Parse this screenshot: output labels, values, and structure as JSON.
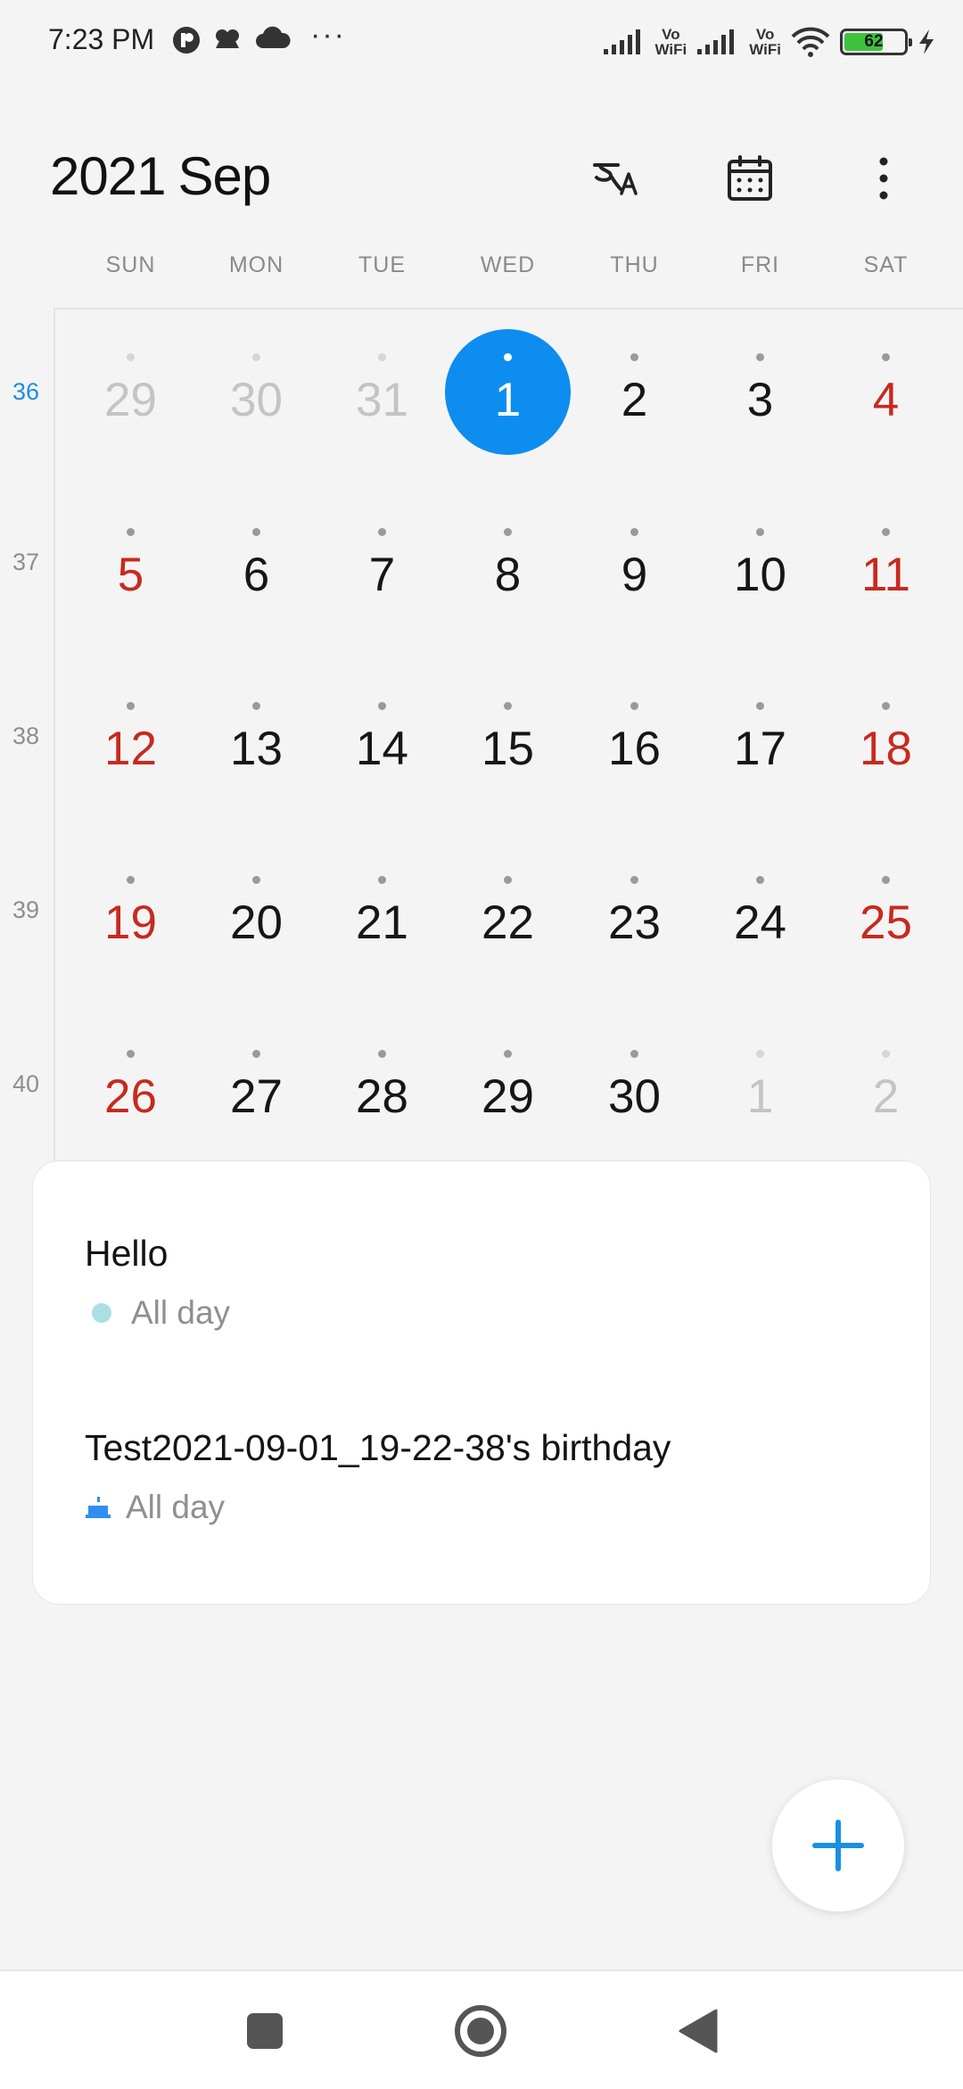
{
  "status_bar": {
    "time": "7:23 PM",
    "more": "···",
    "vowifi_1": [
      "Vo",
      "WiFi"
    ],
    "vowifi_2": [
      "Vo",
      "WiFi"
    ],
    "battery_level": "62"
  },
  "header": {
    "year": "2021",
    "month": "Sep"
  },
  "weekdays": [
    "SUN",
    "MON",
    "TUE",
    "WED",
    "THU",
    "FRI",
    "SAT"
  ],
  "weeks": [
    {
      "number": "36",
      "days": [
        "29",
        "30",
        "31",
        "1",
        "2",
        "3",
        "4"
      ]
    },
    {
      "number": "37",
      "days": [
        "5",
        "6",
        "7",
        "8",
        "9",
        "10",
        "11"
      ]
    },
    {
      "number": "38",
      "days": [
        "12",
        "13",
        "14",
        "15",
        "16",
        "17",
        "18"
      ]
    },
    {
      "number": "39",
      "days": [
        "19",
        "20",
        "21",
        "22",
        "23",
        "24",
        "25"
      ]
    },
    {
      "number": "40",
      "days": [
        "26",
        "27",
        "28",
        "29",
        "30",
        "1",
        "2"
      ]
    }
  ],
  "events": [
    {
      "title": "Hello",
      "time": "All day"
    },
    {
      "title": "Test2021-09-01_19-22-38's birthday",
      "time": "All day"
    }
  ],
  "colors": {
    "accent": "#0d8df0",
    "weekend": "#c8291e",
    "event_dot": "#a9e0e3",
    "birthday_icon": "#2f8ff0"
  }
}
